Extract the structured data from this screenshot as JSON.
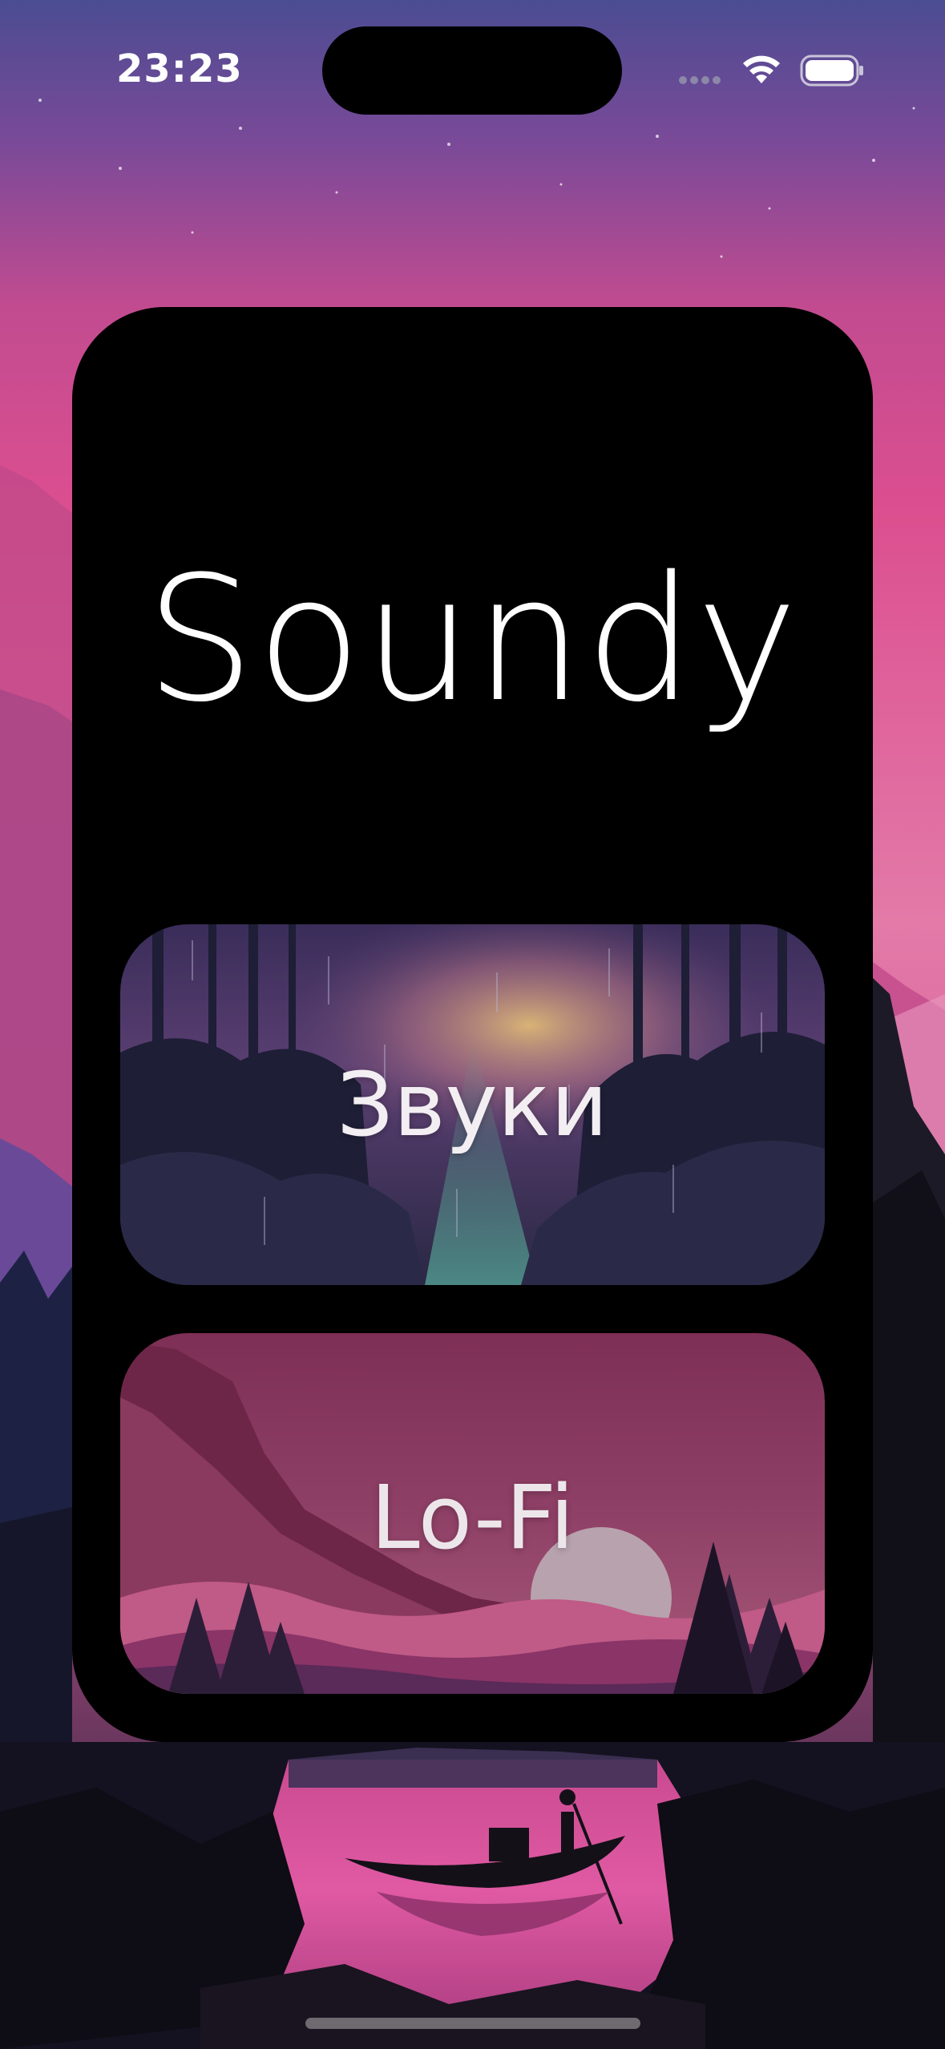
{
  "status_bar": {
    "time": "23:23",
    "icons": [
      "signal-icon",
      "wifi-icon",
      "battery-icon"
    ]
  },
  "app": {
    "title": "Soundy"
  },
  "tiles": [
    {
      "label": "Звуки",
      "image": "rainy-forest-storm-illustration"
    },
    {
      "label": "Lo-Fi",
      "image": "pink-mountains-sunset-illustration"
    }
  ],
  "wallpaper": {
    "image": "lake-boat-silhouette-sunset-illustration"
  },
  "colors": {
    "card_background": "#000000",
    "text": "#ffffff",
    "wallpaper_sky_top": "#4a4a90",
    "wallpaper_sky_mid": "#d84a8e"
  }
}
